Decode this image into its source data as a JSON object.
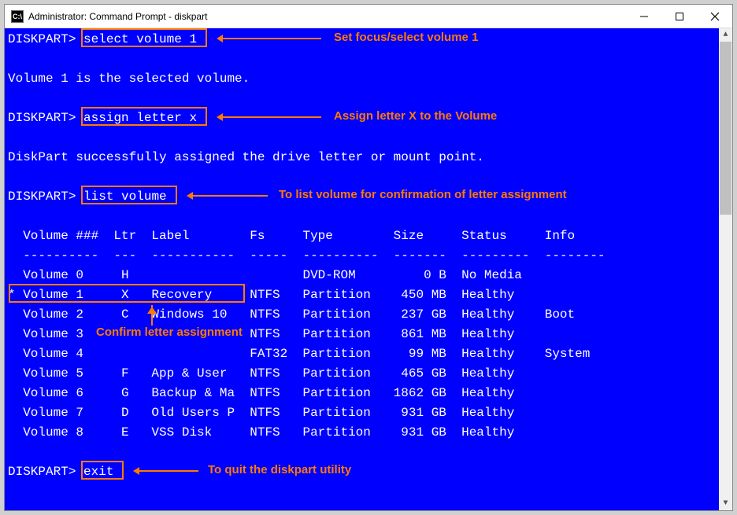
{
  "window": {
    "title": "Administrator: Command Prompt - diskpart",
    "icon_label": "C:\\"
  },
  "prompt": "DISKPART>",
  "cmd": {
    "select": "select volume 1",
    "assign": "assign letter x",
    "list": "list volume",
    "exit": "exit"
  },
  "resp": {
    "selected": "Volume 1 is the selected volume.",
    "assigned": "DiskPart successfully assigned the drive letter or mount point."
  },
  "table": {
    "header": "  Volume ###  Ltr  Label        Fs     Type        Size     Status     Info",
    "divider": "  ----------  ---  -----------  -----  ----------  -------  ---------  --------",
    "rows": [
      "  Volume 0     H                       DVD-ROM         0 B  No Media",
      "* Volume 1     X   Recovery     NTFS   Partition    450 MB  Healthy",
      "  Volume 2     C   Windows 10   NTFS   Partition    237 GB  Healthy    Boot",
      "  Volume 3                      NTFS   Partition    861 MB  Healthy",
      "  Volume 4                      FAT32  Partition     99 MB  Healthy    System",
      "  Volume 5     F   App & User   NTFS   Partition    465 GB  Healthy",
      "  Volume 6     G   Backup & Ma  NTFS   Partition   1862 GB  Healthy",
      "  Volume 7     D   Old Users P  NTFS   Partition    931 GB  Healthy",
      "  Volume 8     E   VSS Disk     NTFS   Partition    931 GB  Healthy"
    ]
  },
  "anno": {
    "select": "Set focus/select volume 1",
    "assign": "Assign letter X to the Volume",
    "list": "To list volume for confirmation of letter assignment",
    "confirm": "Confirm letter assignment",
    "exit": "To quit the diskpart utility"
  },
  "volume_data": [
    {
      "num": 0,
      "ltr": "H",
      "label": "",
      "fs": "",
      "type": "DVD-ROM",
      "size": "0 B",
      "status": "No Media",
      "info": ""
    },
    {
      "num": 1,
      "ltr": "X",
      "label": "Recovery",
      "fs": "NTFS",
      "type": "Partition",
      "size": "450 MB",
      "status": "Healthy",
      "info": "",
      "selected": true
    },
    {
      "num": 2,
      "ltr": "C",
      "label": "Windows 10",
      "fs": "NTFS",
      "type": "Partition",
      "size": "237 GB",
      "status": "Healthy",
      "info": "Boot"
    },
    {
      "num": 3,
      "ltr": "",
      "label": "",
      "fs": "NTFS",
      "type": "Partition",
      "size": "861 MB",
      "status": "Healthy",
      "info": ""
    },
    {
      "num": 4,
      "ltr": "",
      "label": "",
      "fs": "FAT32",
      "type": "Partition",
      "size": "99 MB",
      "status": "Healthy",
      "info": "System"
    },
    {
      "num": 5,
      "ltr": "F",
      "label": "App & User",
      "fs": "NTFS",
      "type": "Partition",
      "size": "465 GB",
      "status": "Healthy",
      "info": ""
    },
    {
      "num": 6,
      "ltr": "G",
      "label": "Backup & Ma",
      "fs": "NTFS",
      "type": "Partition",
      "size": "1862 GB",
      "status": "Healthy",
      "info": ""
    },
    {
      "num": 7,
      "ltr": "D",
      "label": "Old Users P",
      "fs": "NTFS",
      "type": "Partition",
      "size": "931 GB",
      "status": "Healthy",
      "info": ""
    },
    {
      "num": 8,
      "ltr": "E",
      "label": "VSS Disk",
      "fs": "NTFS",
      "type": "Partition",
      "size": "931 GB",
      "status": "Healthy",
      "info": ""
    }
  ],
  "colors": {
    "terminal_bg": "#0000ff",
    "terminal_fg": "#ffffff",
    "annotation": "#ff7a00"
  }
}
